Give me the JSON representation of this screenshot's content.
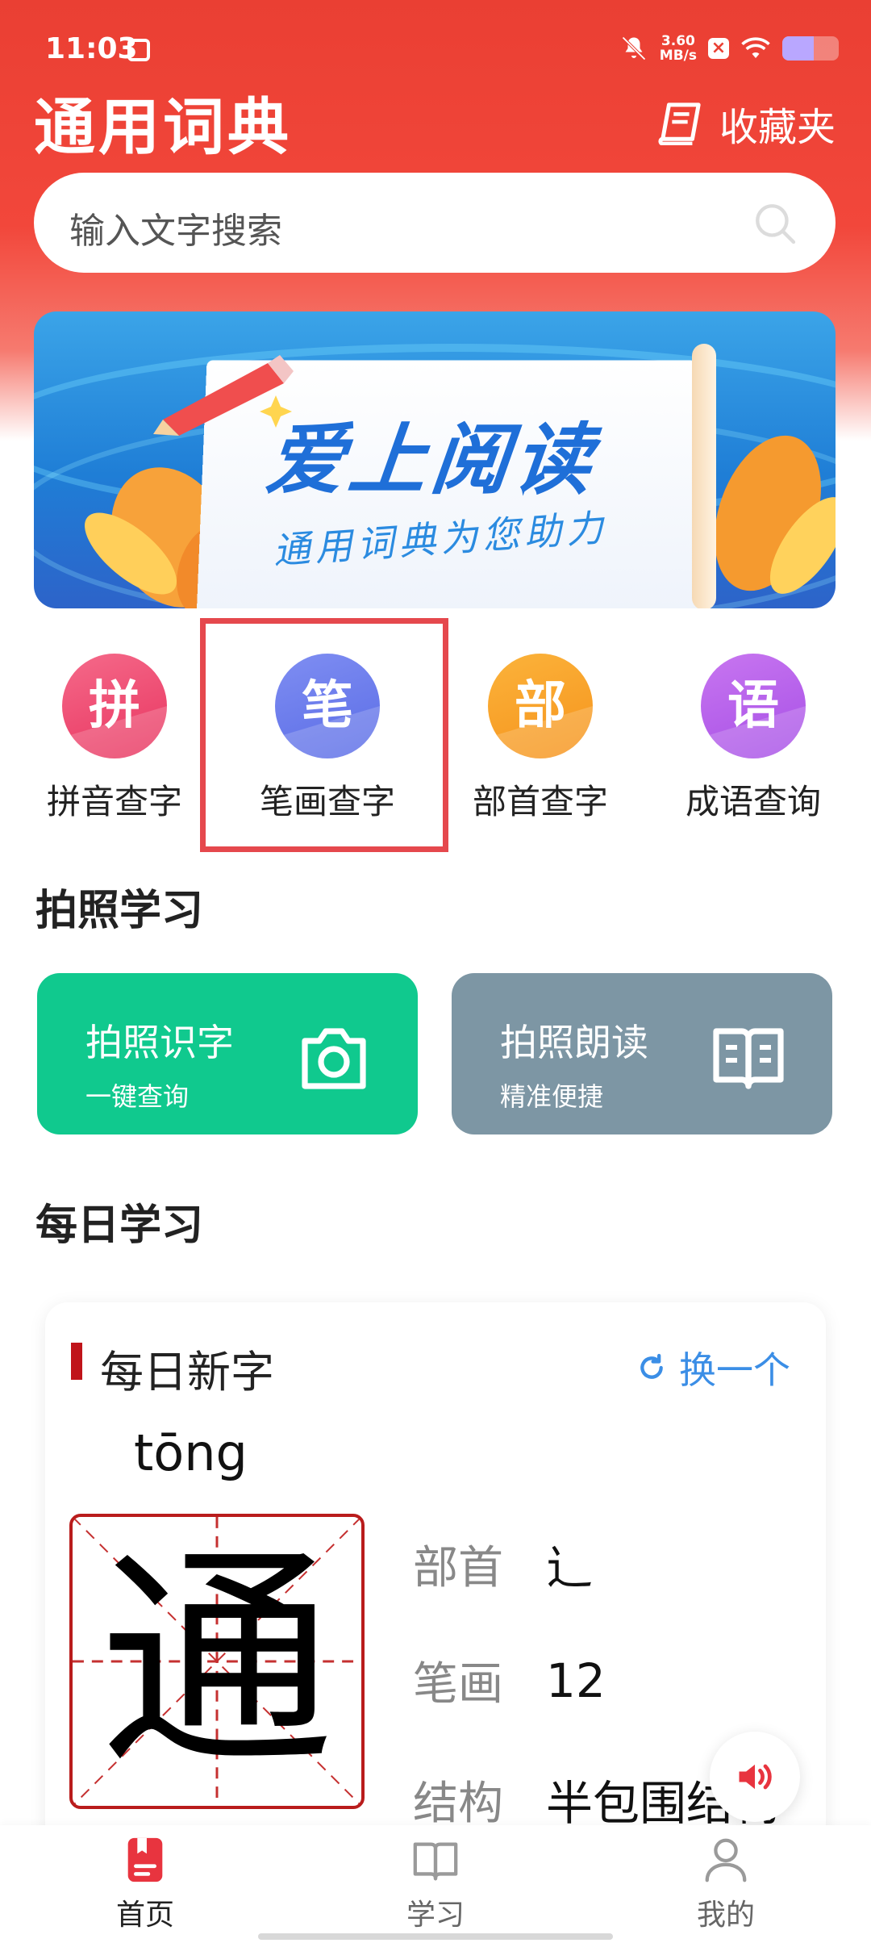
{
  "status_bar": {
    "time": "11:03",
    "net_speed_value": "3.60",
    "net_speed_unit": "MB/s",
    "battery_level": 0.55
  },
  "header": {
    "title": "通用词典",
    "favorites_label": "收藏夹"
  },
  "search": {
    "placeholder": "输入文字搜索"
  },
  "banner": {
    "headline": "爱上阅读",
    "subtitle": "通用词典为您助力"
  },
  "quick_entries": [
    {
      "icon_char": "拼",
      "label": "拼音查字",
      "color_top": "#f56a8a",
      "color_bottom": "#e8345f"
    },
    {
      "icon_char": "笔",
      "label": "笔画查字",
      "color_top": "#7f8ef2",
      "color_bottom": "#5a6ce6"
    },
    {
      "icon_char": "部",
      "label": "部首查字",
      "color_top": "#fbb33b",
      "color_bottom": "#f6931c"
    },
    {
      "icon_char": "语",
      "label": "成语查询",
      "color_top": "#c876f0",
      "color_bottom": "#a64fe6"
    }
  ],
  "photo_section": {
    "title": "拍照学习",
    "cards": [
      {
        "title": "拍照识字",
        "subtitle": "一键查询",
        "color": "#10c98e",
        "icon": "camera-icon"
      },
      {
        "title": "拍照朗读",
        "subtitle": "精准便捷",
        "color": "#7d96a4",
        "icon": "open-book-icon"
      }
    ]
  },
  "daily_section": {
    "title": "每日学习",
    "card_title": "每日新字",
    "refresh_label": "换一个",
    "pinyin": "tōng",
    "character": "通",
    "rows": [
      {
        "key": "部首",
        "value": "辶"
      },
      {
        "key": "笔画",
        "value": "12"
      },
      {
        "key": "结构",
        "value": "半包围结构"
      }
    ]
  },
  "bottom_nav": [
    {
      "label": "首页",
      "icon": "home-doc-icon",
      "active": true
    },
    {
      "label": "学习",
      "icon": "book-icon",
      "active": false
    },
    {
      "label": "我的",
      "icon": "user-icon",
      "active": false
    }
  ],
  "colors": {
    "brand_red": "#ea3f33",
    "highlight_border": "#e5484d",
    "refresh_blue": "#3b8ee6",
    "nav_active": "#e8343f",
    "nav_inactive": "#9a9a9a"
  }
}
